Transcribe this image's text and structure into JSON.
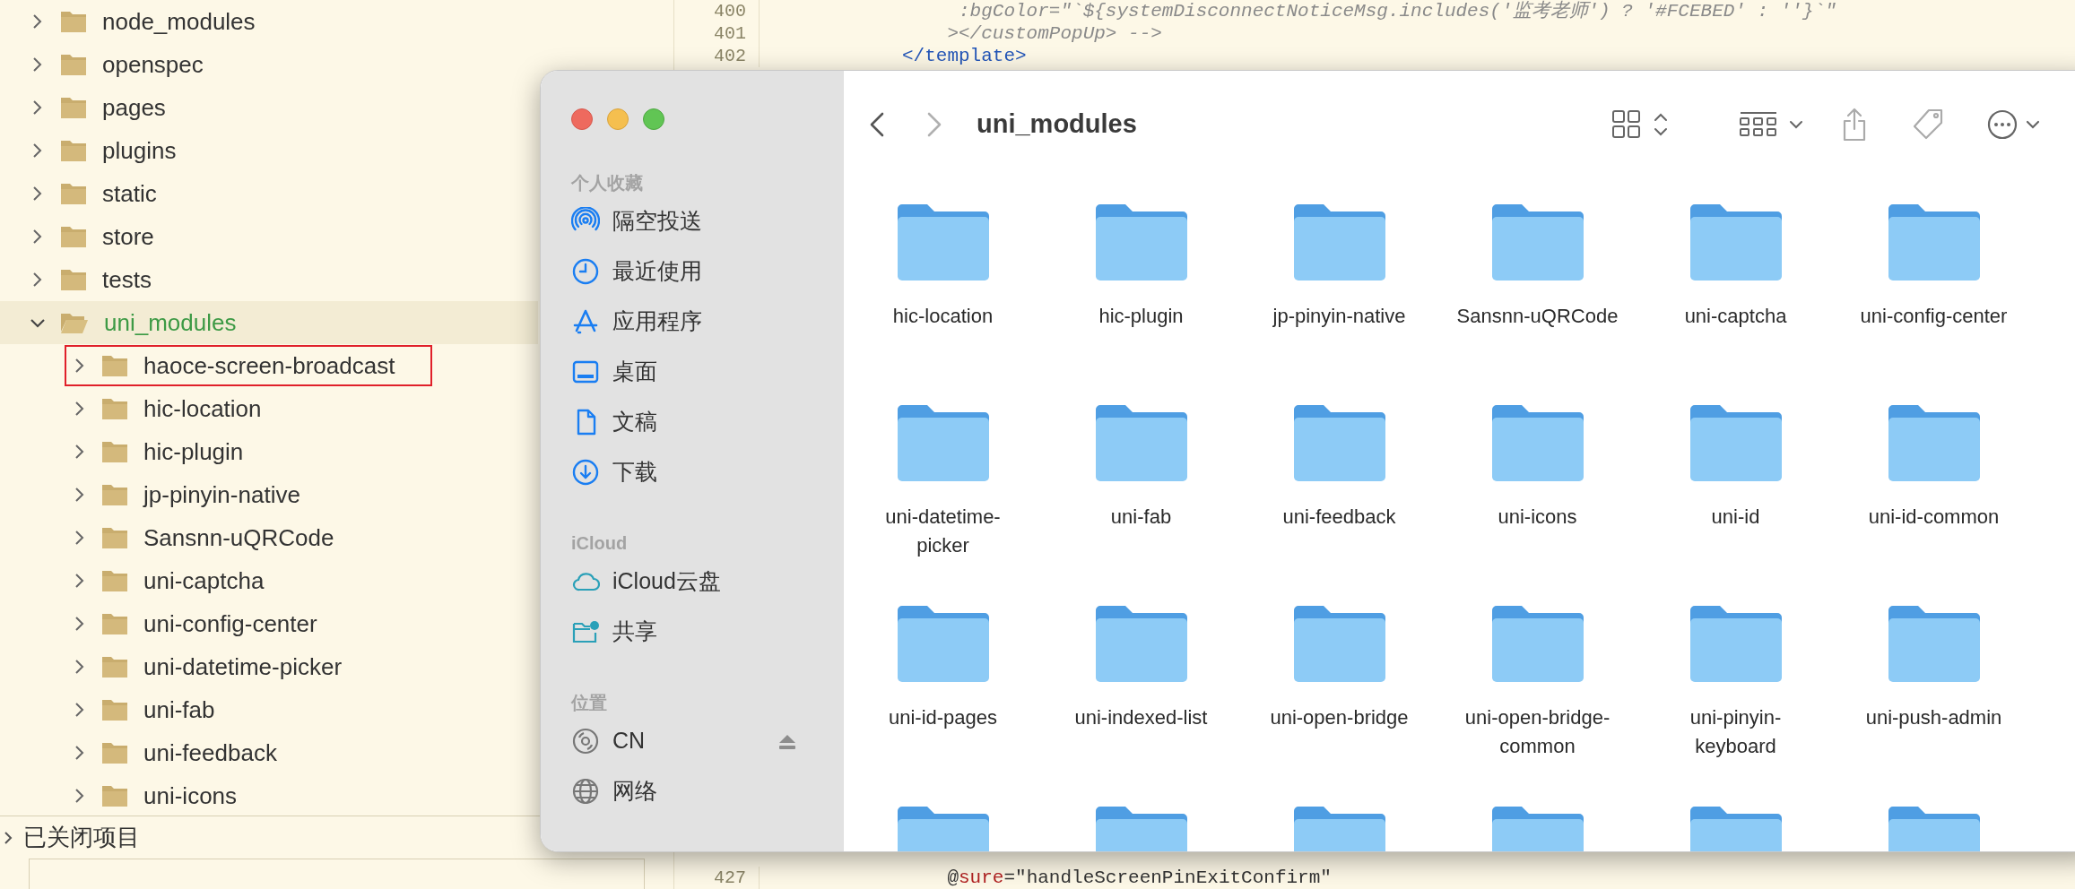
{
  "file_tree": {
    "items": [
      {
        "label": "node_modules",
        "expanded": false,
        "selected": false
      },
      {
        "label": "openspec",
        "expanded": false,
        "selected": false
      },
      {
        "label": "pages",
        "expanded": false,
        "selected": false
      },
      {
        "label": "plugins",
        "expanded": false,
        "selected": false
      },
      {
        "label": "static",
        "expanded": false,
        "selected": false
      },
      {
        "label": "store",
        "expanded": false,
        "selected": false
      },
      {
        "label": "tests",
        "expanded": false,
        "selected": false
      },
      {
        "label": "uni_modules",
        "expanded": true,
        "selected": true,
        "children": [
          {
            "label": "haoce-screen-broadcast",
            "expanded": false,
            "highlighted": true
          },
          {
            "label": "hic-location",
            "expanded": false,
            "highlighted": false
          },
          {
            "label": "hic-plugin",
            "expanded": false,
            "highlighted": false
          },
          {
            "label": "jp-pinyin-native",
            "expanded": false,
            "highlighted": false
          },
          {
            "label": "Sansnn-uQRCode",
            "expanded": false,
            "highlighted": false
          },
          {
            "label": "uni-captcha",
            "expanded": false,
            "highlighted": false
          },
          {
            "label": "uni-config-center",
            "expanded": false,
            "highlighted": false
          },
          {
            "label": "uni-datetime-picker",
            "expanded": false,
            "highlighted": false
          },
          {
            "label": "uni-fab",
            "expanded": false,
            "highlighted": false
          },
          {
            "label": "uni-feedback",
            "expanded": false,
            "highlighted": false
          },
          {
            "label": "uni-icons",
            "expanded": false,
            "highlighted": false
          }
        ]
      }
    ]
  },
  "closed_projects": {
    "label": "已关闭项目"
  },
  "editor": {
    "top_lines": [
      {
        "number": "400",
        "tokens": [
          {
            "text": "     :bgColor=\"`${systemDisconnectNoticeMsg.includes('监考老师') ? '#FCEBED' : ''}`\"",
            "kind": "comment"
          }
        ]
      },
      {
        "number": "401",
        "tokens": [
          {
            "text": "    ></customPopUp> -->",
            "kind": "comment"
          }
        ]
      },
      {
        "number": "402",
        "tokens": [
          {
            "text": "</template>",
            "kind": "tag"
          }
        ]
      }
    ],
    "bottom_lines": [
      {
        "number": "427",
        "tokens": [
          {
            "text": "    @",
            "kind": "plain"
          },
          {
            "text": "sure",
            "kind": "attr"
          },
          {
            "text": "=\"handleScreenPinExitConfirm\"",
            "kind": "plain"
          }
        ]
      }
    ]
  },
  "finder": {
    "toolbar": {
      "title": "uni_modules"
    },
    "sidebar": [
      {
        "title": "个人收藏",
        "items": [
          {
            "label": "隔空投送",
            "kind": "airdrop"
          },
          {
            "label": "最近使用",
            "kind": "recents"
          },
          {
            "label": "应用程序",
            "kind": "apps"
          },
          {
            "label": "桌面",
            "kind": "desktop"
          },
          {
            "label": "文稿",
            "kind": "document"
          },
          {
            "label": "下载",
            "kind": "download"
          }
        ]
      },
      {
        "title": "iCloud",
        "items": [
          {
            "label": "iCloud云盘",
            "kind": "cloud"
          },
          {
            "label": "共享",
            "kind": "shared"
          }
        ]
      },
      {
        "title": "位置",
        "items": [
          {
            "label": "CN",
            "kind": "disk"
          },
          {
            "label": "网络",
            "kind": "network"
          }
        ]
      }
    ],
    "files": [
      {
        "label": "hic-location"
      },
      {
        "label": "hic-plugin"
      },
      {
        "label": "jp-pinyin-native"
      },
      {
        "label": "Sansnn-uQRCode"
      },
      {
        "label": "uni-captcha"
      },
      {
        "label": "uni-config-center"
      },
      {
        "label": "uni-datetime-picker"
      },
      {
        "label": "uni-fab"
      },
      {
        "label": "uni-feedback"
      },
      {
        "label": "uni-icons"
      },
      {
        "label": "uni-id"
      },
      {
        "label": "uni-id-common"
      },
      {
        "label": "uni-id-pages"
      },
      {
        "label": "uni-indexed-list"
      },
      {
        "label": "uni-open-bridge"
      },
      {
        "label": "uni-open-bridge-common"
      },
      {
        "label": "uni-pinyin-keyboard"
      },
      {
        "label": "uni-push-admin"
      },
      {
        "kind": "folder"
      },
      {
        "kind": "folder"
      },
      {
        "kind": "folder"
      },
      {
        "kind": "folder"
      },
      {
        "kind": "folder"
      },
      {
        "kind": "folder"
      }
    ]
  }
}
